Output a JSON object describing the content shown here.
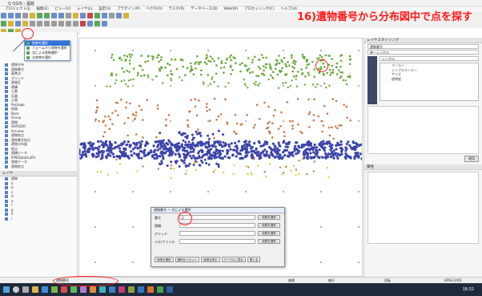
{
  "window": {
    "title": "Q QGIS - 遺跡"
  },
  "menubar": [
    "プロジェクト(J)",
    "編集(E)",
    "ビュー(V)",
    "レイヤ(L)",
    "設定(S)",
    "プラグイン(P)",
    "ベクタ(O)",
    "ラスタ(R)",
    "データベース(D)",
    "Web(W)",
    "プロセッシング(C)",
    "ヘルプ(H)"
  ],
  "annotation": "16)遺物番号から分布図中で点を探す",
  "dropdown": {
    "items": [
      "地物を選択",
      "フォームから地物を選択",
      "式による地物選択",
      "全地物を選択"
    ]
  },
  "layers": [
    "遺物分布",
    "遺物番号",
    "基準点",
    "グリッド",
    "調査区",
    "遺構",
    "土層",
    "石器",
    "土器",
    "Package",
    "地図",
    "Base",
    "Group",
    "遺物",
    "SHP2DXF",
    "Arcview",
    "遺物地点",
    "遺物番号地点",
    "遺物分布図",
    "地点",
    "遺構データ",
    "PIPEDataOutFit",
    "調査データ",
    "遺物地点"
  ],
  "layers_panel": {
    "title": "レイヤ",
    "rows": [
      "遺物",
      "a",
      "b",
      "c",
      "d",
      "e",
      "f",
      "g",
      "h",
      "i"
    ]
  },
  "right_panel": {
    "title": "レイヤスタイリング",
    "layer_field": "遺物番号",
    "renderer": "単一シンボル",
    "symbol": "シンボル",
    "rows": [
      "マーカー",
      "シンプルマーカー",
      "サイズ",
      "透明度"
    ],
    "apply": "適用",
    "browser_title": "属性"
  },
  "dialog": {
    "title": "遺物番号 — 式による選択",
    "rows": [
      {
        "label": "番号",
        "value": "2",
        "btn": "地物を選択"
      },
      {
        "label": "遺構",
        "value": "",
        "btn": "地物を選択"
      },
      {
        "label": "グリッド",
        "value": "",
        "btn": "地物を選択"
      },
      {
        "label": "メモ/ファイル",
        "value": "",
        "btn": "地物を選択"
      }
    ],
    "buttons": [
      "地物を選択",
      "選択をリセット",
      "地物を表示",
      "テーブルに表示",
      "閉じる"
    ]
  },
  "status": {
    "left": "遺物番号",
    "coordinate": "座標",
    "scale": "縮尺",
    "rotation": "回転",
    "epsg": "EPSG:2451"
  },
  "taskbar": {
    "clock": "18:32"
  },
  "colors": {
    "green": "#6aa83c",
    "orange": "#c8794e",
    "blue": "#3c44a8",
    "yellow": "#d9d24a",
    "highlight": "#ff1a1a"
  }
}
